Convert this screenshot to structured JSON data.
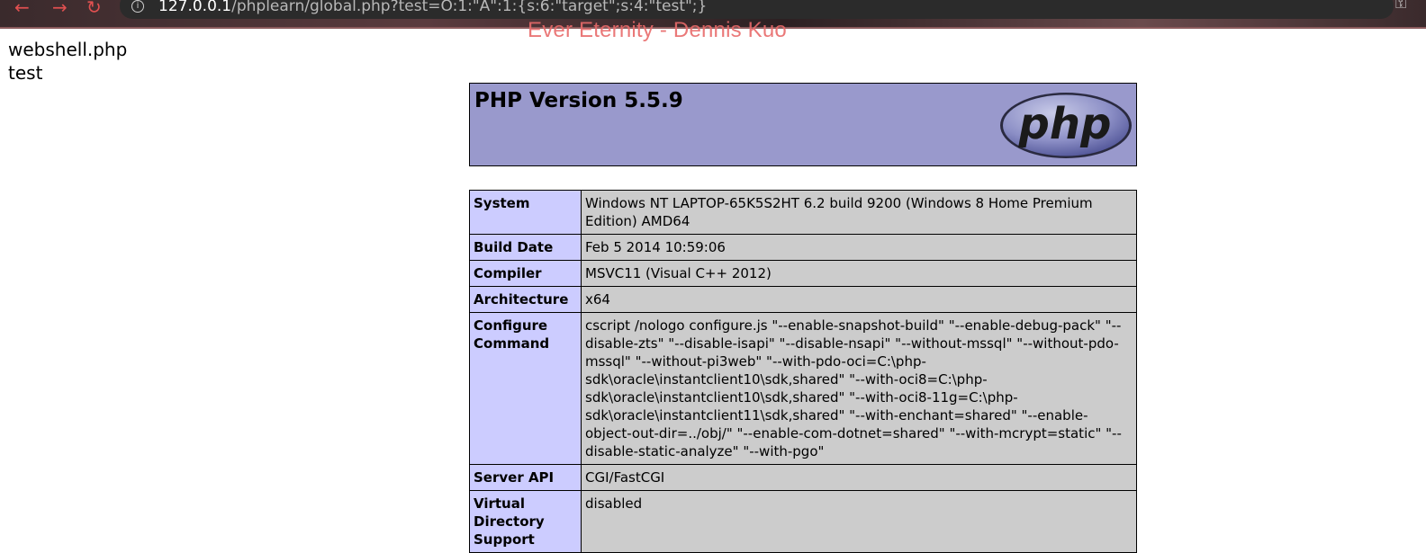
{
  "browser": {
    "back_icon": "back-arrow-icon",
    "forward_icon": "forward-arrow-icon",
    "reload_icon": "reload-icon",
    "url_host": "127.0.0.1",
    "url_path": "/phplearn/global.php?test=O:1:\"A\":1:{s:6:\"target\";s:4:\"test\";}",
    "media_title": "Ever Eternity - Dennis Kuo",
    "accent_color": "#e05050"
  },
  "output": {
    "line1": "webshell.php",
    "line2": "test"
  },
  "phpinfo": {
    "title": "PHP Version 5.5.9",
    "logo_text": "php",
    "header_color": "#9999cc",
    "rows": [
      {
        "key": "System",
        "value": "Windows NT LAPTOP-65K5S2HT 6.2 build 9200 (Windows 8 Home Premium Edition) AMD64"
      },
      {
        "key": "Build Date",
        "value": "Feb 5 2014 10:59:06"
      },
      {
        "key": "Compiler",
        "value": "MSVC11 (Visual C++ 2012)"
      },
      {
        "key": "Architecture",
        "value": "x64"
      },
      {
        "key": "Configure Command",
        "value": "cscript /nologo configure.js \"--enable-snapshot-build\" \"--enable-debug-pack\" \"--disable-zts\" \"--disable-isapi\" \"--disable-nsapi\" \"--without-mssql\" \"--without-pdo-mssql\" \"--without-pi3web\" \"--with-pdo-oci=C:\\php-sdk\\oracle\\instantclient10\\sdk,shared\" \"--with-oci8=C:\\php-sdk\\oracle\\instantclient10\\sdk,shared\" \"--with-oci8-11g=C:\\php-sdk\\oracle\\instantclient11\\sdk,shared\" \"--with-enchant=shared\" \"--enable-object-out-dir=../obj/\" \"--enable-com-dotnet=shared\" \"--with-mcrypt=static\" \"--disable-static-analyze\" \"--with-pgo\""
      },
      {
        "key": "Server API",
        "value": "CGI/FastCGI"
      },
      {
        "key": "Virtual Directory Support",
        "value": "disabled"
      }
    ]
  }
}
